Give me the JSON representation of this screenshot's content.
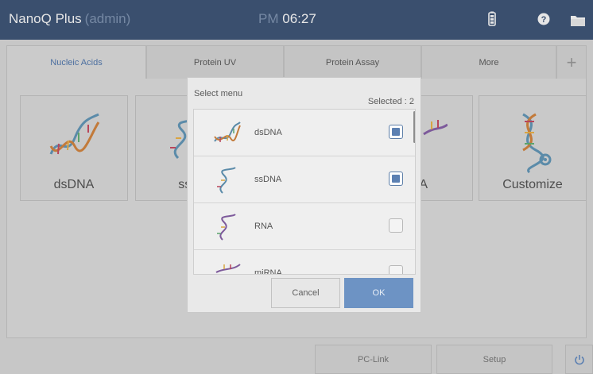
{
  "topbar": {
    "app_name": "NanoQ Plus",
    "user": "(admin)",
    "ampm": "PM",
    "time": "06:27",
    "icons": [
      "battery-icon",
      "help-icon",
      "folder-icon"
    ]
  },
  "tabs": [
    {
      "label": "Nucleic Acids",
      "active": true
    },
    {
      "label": "Protein UV",
      "active": false
    },
    {
      "label": "Protein Assay",
      "active": false
    },
    {
      "label": "More",
      "active": false
    },
    {
      "label": "+",
      "active": false
    }
  ],
  "tiles": [
    {
      "label": "dsDNA",
      "icon": "dsdna-icon"
    },
    {
      "label": "ssD",
      "icon": "ssdna-icon"
    },
    {
      "label": "NA",
      "icon": "rna-icon"
    },
    {
      "label": "Customize",
      "icon": "customize-dna-icon"
    }
  ],
  "dialog": {
    "title": "Select menu",
    "selected_label": "Selected : 2",
    "items": [
      {
        "name": "dsDNA",
        "checked": true
      },
      {
        "name": "ssDNA",
        "checked": true
      },
      {
        "name": "RNA",
        "checked": false
      },
      {
        "name": "miRNA",
        "checked": false
      }
    ],
    "cancel_label": "Cancel",
    "ok_label": "OK"
  },
  "bottombar": {
    "pclink_label": "PC-Link",
    "setup_label": "Setup",
    "power_icon": "power-icon"
  },
  "colors": {
    "topbar": "#3a4f6e",
    "accent": "#6d93c4",
    "checkbox_fill": "#5c80b2"
  }
}
